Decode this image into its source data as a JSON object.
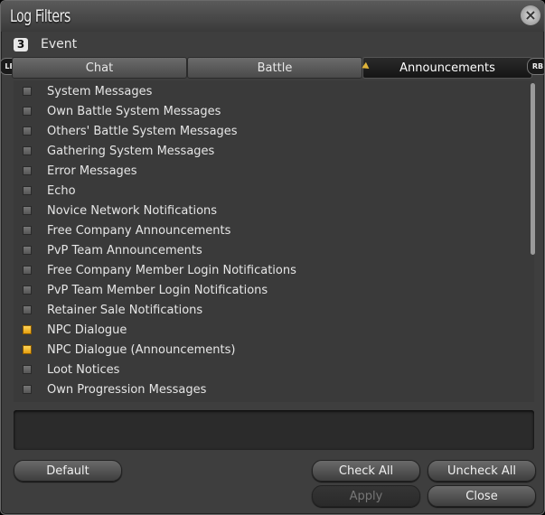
{
  "window": {
    "title": "Log Filters",
    "close_glyph": "⨯"
  },
  "event": {
    "icon": "3",
    "label": "Event"
  },
  "bumpers": {
    "left": "LB",
    "right": "RB"
  },
  "tabs": [
    {
      "label": "Chat",
      "active": false
    },
    {
      "label": "Battle",
      "active": false
    },
    {
      "label": "Announcements",
      "active": true
    }
  ],
  "filters": [
    {
      "label": "System Messages",
      "checked": false
    },
    {
      "label": "Own Battle System Messages",
      "checked": false
    },
    {
      "label": "Others' Battle System Messages",
      "checked": false
    },
    {
      "label": "Gathering System Messages",
      "checked": false
    },
    {
      "label": "Error Messages",
      "checked": false
    },
    {
      "label": "Echo",
      "checked": false
    },
    {
      "label": "Novice Network Notifications",
      "checked": false
    },
    {
      "label": "Free Company Announcements",
      "checked": false
    },
    {
      "label": "PvP Team Announcements",
      "checked": false
    },
    {
      "label": "Free Company Member Login Notifications",
      "checked": false
    },
    {
      "label": "PvP Team Member Login Notifications",
      "checked": false
    },
    {
      "label": "Retainer Sale Notifications",
      "checked": false
    },
    {
      "label": "NPC Dialogue",
      "checked": true
    },
    {
      "label": "NPC Dialogue (Announcements)",
      "checked": true
    },
    {
      "label": "Loot Notices",
      "checked": false
    },
    {
      "label": "Own Progression Messages",
      "checked": false
    }
  ],
  "buttons": {
    "default": "Default",
    "check_all": "Check All",
    "uncheck_all": "Uncheck All",
    "apply": "Apply",
    "close": "Close"
  },
  "colors": {
    "accent": "#f0b429",
    "window_bg": "#3e3e3e"
  }
}
